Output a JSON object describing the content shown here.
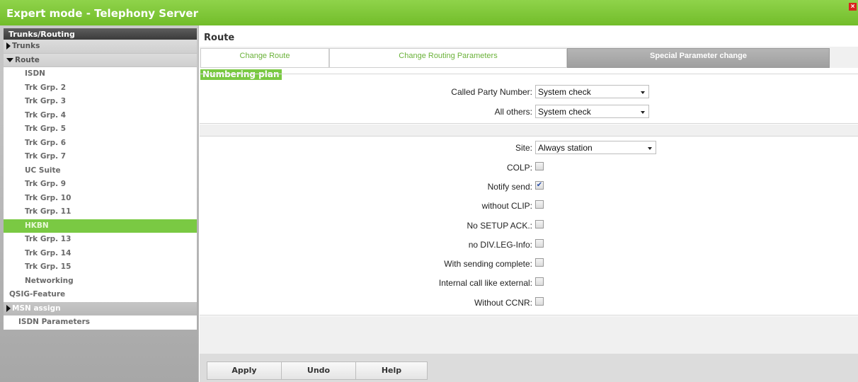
{
  "window": {
    "title": "Expert mode - Telephony Server",
    "close_label": "×"
  },
  "sidebar": {
    "header": "Trunks/Routing",
    "items": [
      {
        "label": "Trunks",
        "kind": "group",
        "icon": "triangle-right-icon"
      },
      {
        "label": "Route",
        "kind": "group",
        "icon": "triangle-down-icon"
      },
      {
        "label": "ISDN",
        "kind": "child"
      },
      {
        "label": "Trk Grp. 2",
        "kind": "child"
      },
      {
        "label": "Trk Grp. 3",
        "kind": "child"
      },
      {
        "label": "Trk Grp. 4",
        "kind": "child"
      },
      {
        "label": "Trk Grp. 5",
        "kind": "child"
      },
      {
        "label": "Trk Grp. 6",
        "kind": "child"
      },
      {
        "label": "Trk Grp. 7",
        "kind": "child"
      },
      {
        "label": "UC Suite",
        "kind": "child"
      },
      {
        "label": "Trk Grp. 9",
        "kind": "child"
      },
      {
        "label": "Trk Grp. 10",
        "kind": "child"
      },
      {
        "label": "Trk Grp. 11",
        "kind": "child"
      },
      {
        "label": "HKBN",
        "kind": "active"
      },
      {
        "label": "Trk Grp. 13",
        "kind": "child"
      },
      {
        "label": "Trk Grp. 14",
        "kind": "child"
      },
      {
        "label": "Trk Grp. 15",
        "kind": "child"
      },
      {
        "label": "Networking",
        "kind": "child"
      },
      {
        "label": "QSIG-Feature",
        "kind": "subgroup"
      },
      {
        "label": "MSN assign",
        "kind": "grey-group",
        "icon": "triangle-right-icon"
      },
      {
        "label": "ISDN Parameters",
        "kind": "plain"
      }
    ]
  },
  "main": {
    "title": "Route",
    "tabs": [
      {
        "label": "Change Route",
        "active": false
      },
      {
        "label": "Change Routing Parameters",
        "active": false
      },
      {
        "label": "Special Parameter change",
        "active": true
      }
    ],
    "numbering_plan": {
      "section_label": "Numbering plan",
      "called_party_label": "Called Party Number:",
      "called_party_value": "System check",
      "all_others_label": "All others:",
      "all_others_value": "System check"
    },
    "options": {
      "site_label": "Site:",
      "site_value": "Always station",
      "checkboxes": [
        {
          "label": "COLP:",
          "checked": false
        },
        {
          "label": "Notify send:",
          "checked": true
        },
        {
          "label": "without CLIP:",
          "checked": false
        },
        {
          "label": "No SETUP ACK.:",
          "checked": false
        },
        {
          "label": "no DIV.LEG-Info:",
          "checked": false
        },
        {
          "label": "With sending complete:",
          "checked": false
        },
        {
          "label": "Internal call like external:",
          "checked": false
        },
        {
          "label": "Without CCNR:",
          "checked": false
        }
      ]
    },
    "buttons": {
      "apply": "Apply",
      "undo": "Undo",
      "help": "Help"
    }
  },
  "colors": {
    "brand_green": "#7ac943",
    "tab_text_green": "#6bb23a",
    "active_tab_grey": "#a8a8a8"
  }
}
